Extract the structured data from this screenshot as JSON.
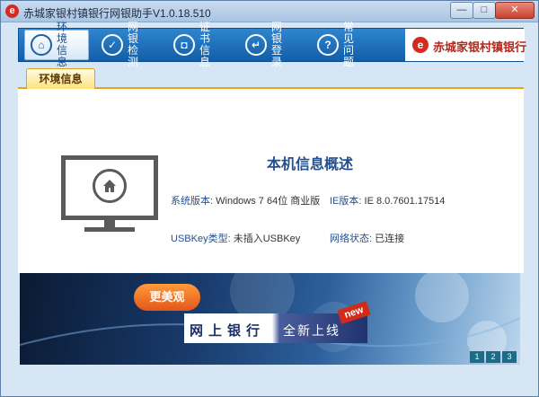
{
  "window": {
    "title": "赤城家银村镇银行网银助手V1.0.18.510",
    "app_logo_glyph": "e",
    "controls": {
      "minimize": "—",
      "maximize": "□",
      "close": "✕"
    }
  },
  "nav": {
    "items": [
      {
        "label": "环境信息",
        "icon": "home-icon",
        "glyph": "⌂",
        "active": true
      },
      {
        "label": "网银检测",
        "icon": "shield-check-icon",
        "glyph": "✓",
        "active": false
      },
      {
        "label": "证书信息",
        "icon": "certificate-icon",
        "glyph": "◘",
        "active": false
      },
      {
        "label": "网银登录",
        "icon": "login-icon",
        "glyph": "↵",
        "active": false
      },
      {
        "label": "常见问题",
        "icon": "question-icon",
        "glyph": "?",
        "active": false
      }
    ],
    "bank_logo": {
      "glyph": "e",
      "text": "赤城家银村镇银行"
    }
  },
  "tabs": [
    {
      "label": "环境信息",
      "active": true
    }
  ],
  "info": {
    "title": "本机信息概述",
    "os_label": "系统版本:",
    "os_value": "Windows 7 64位 商业版",
    "ie_label": "IE版本:",
    "ie_value": "IE 8.0.7601.17514",
    "usbkey_label": "USBKey类型:",
    "usbkey_value": "未插入USBKey",
    "network_label": "网络状态:",
    "network_value": "已连接"
  },
  "banner": {
    "badge": "更美观",
    "line_a": "网上银行",
    "line_b": "全新上线",
    "new_tag": "new",
    "pages": [
      "1",
      "2",
      "3"
    ]
  },
  "colors": {
    "nav_blue": "#1a67b3",
    "info_label_blue": "#244f8f",
    "tab_gold": "#e6a51a",
    "brand_red": "#d42a1f"
  }
}
